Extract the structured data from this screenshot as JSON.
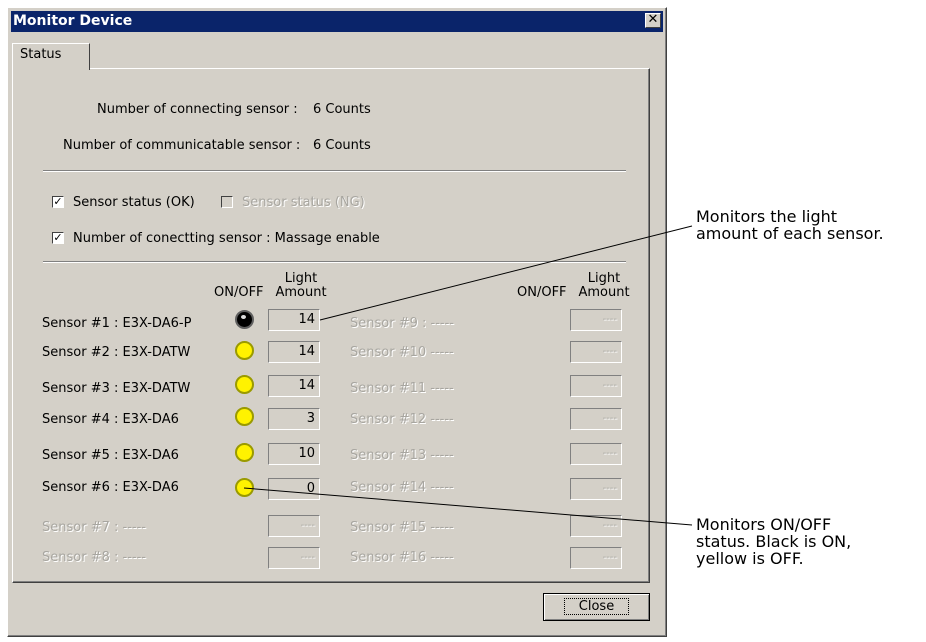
{
  "window": {
    "title": "Monitor Device",
    "close_glyph": "✕"
  },
  "tab": {
    "label": "Status"
  },
  "summary": {
    "connecting_label": "Number of connecting sensor :",
    "connecting_value": "6 Counts",
    "communicatable_label": "Number of communicatable sensor :",
    "communicatable_value": "6 Counts"
  },
  "options": {
    "ok_label": "Sensor status (OK)",
    "ok_checked": true,
    "ng_label": "Sensor status (NG)",
    "ng_checked": false,
    "msg_label": "Number of conectting sensor : Massage enable",
    "msg_checked": true
  },
  "headers": {
    "onoff": "ON/OFF",
    "light_1": "Light",
    "light_2": "Amount"
  },
  "left_sensors": [
    {
      "label": "Sensor #1 : E3X-DA6-P",
      "state": "on",
      "amount": "14"
    },
    {
      "label": "Sensor #2 : E3X-DATW",
      "state": "off",
      "amount": "14"
    },
    {
      "label": "Sensor #3 : E3X-DATW",
      "state": "off",
      "amount": "14"
    },
    {
      "label": "Sensor #4 : E3X-DA6",
      "state": "off",
      "amount": "3"
    },
    {
      "label": "Sensor #5 : E3X-DA6",
      "state": "off",
      "amount": "10"
    },
    {
      "label": "Sensor #6 : E3X-DA6",
      "state": "off",
      "amount": "0"
    },
    {
      "label": "Sensor #7 : -----",
      "state": "none",
      "amount": "----"
    },
    {
      "label": "Sensor #8 : -----",
      "state": "none",
      "amount": "----"
    }
  ],
  "right_sensors": [
    {
      "label": "Sensor #9 : -----",
      "amount": "----"
    },
    {
      "label": "Sensor #10 -----",
      "amount": "----"
    },
    {
      "label": "Sensor #11 -----",
      "amount": "----"
    },
    {
      "label": "Sensor #12 -----",
      "amount": "----"
    },
    {
      "label": "Sensor #13 -----",
      "amount": "----"
    },
    {
      "label": "Sensor #14 -----",
      "amount": "----"
    },
    {
      "label": "Sensor #15 -----",
      "amount": "----"
    },
    {
      "label": "Sensor #16 -----",
      "amount": "----"
    }
  ],
  "close_button": "Close",
  "annotations": {
    "light_1": "Monitors the light",
    "light_2": "amount of each sensor.",
    "onoff_1": "Monitors ON/OFF",
    "onoff_2": "status. Black is ON,",
    "onoff_3": "yellow is OFF."
  },
  "colors": {
    "titlebar": "#0a246a",
    "face": "#d4d0c8",
    "led_off": "#fff200",
    "led_on": "#000000"
  }
}
